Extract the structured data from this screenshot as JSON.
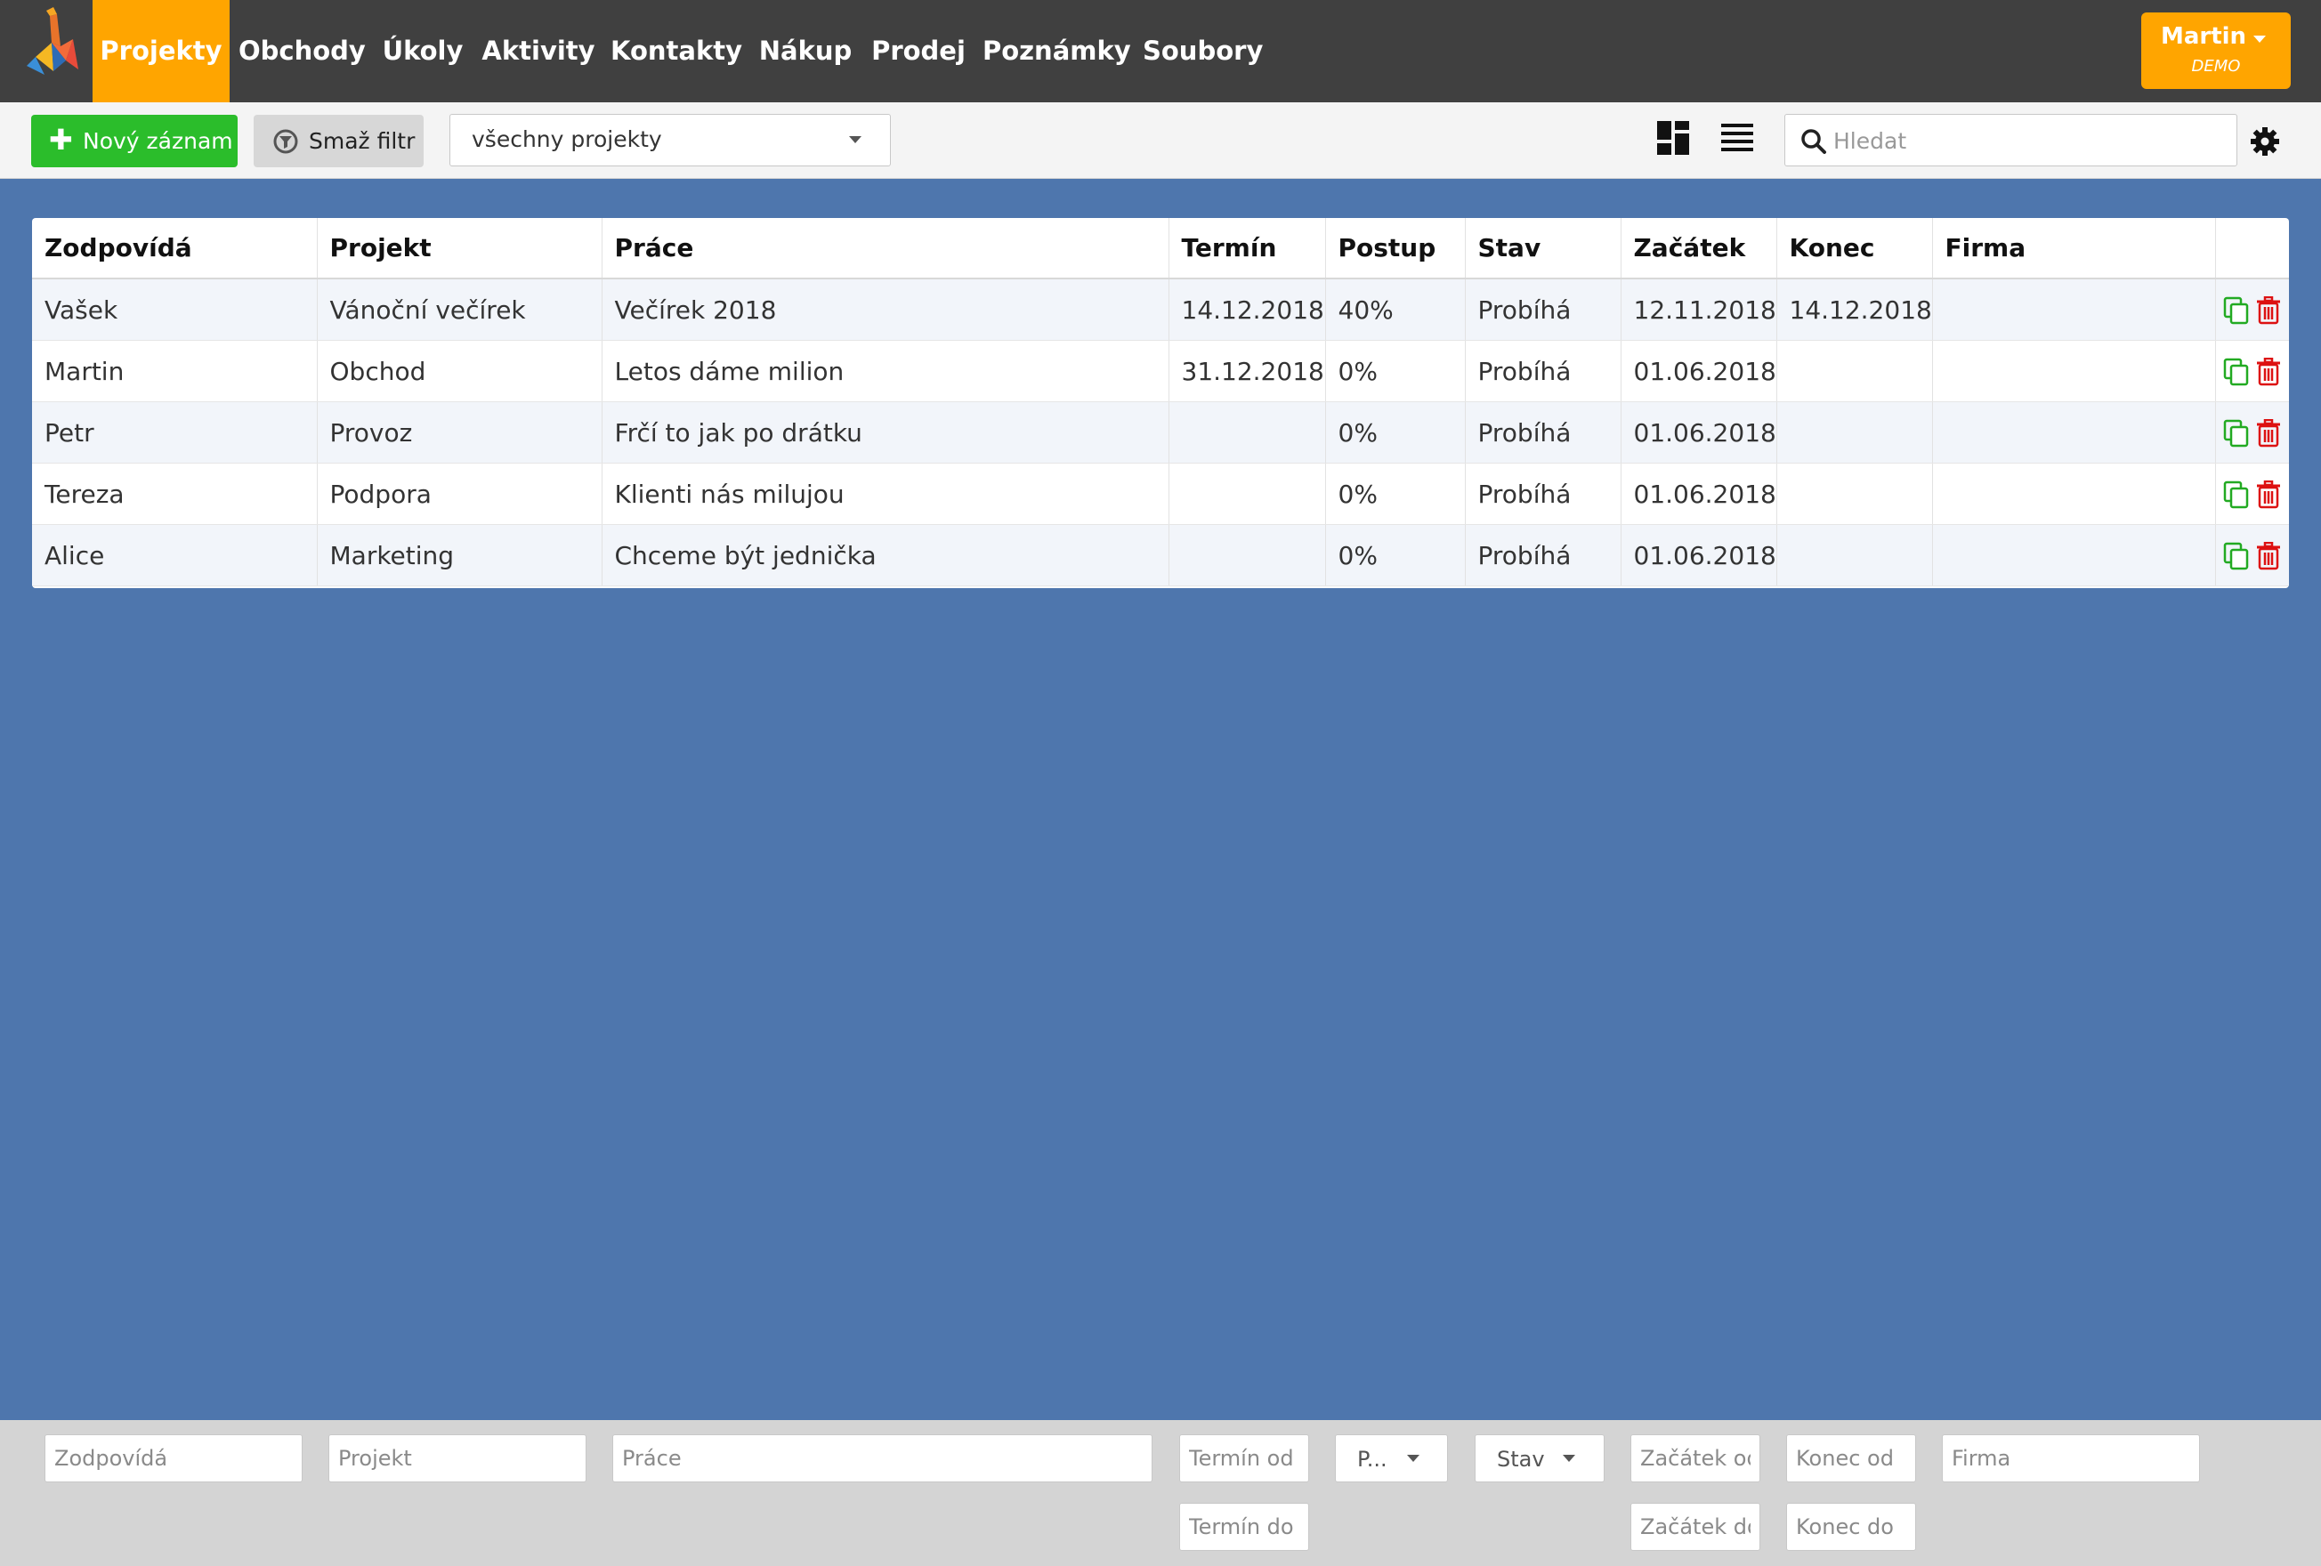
{
  "nav": {
    "items": [
      {
        "label": "Projekty",
        "active": true
      },
      {
        "label": "Obchody"
      },
      {
        "label": "Úkoly"
      },
      {
        "label": "Aktivity"
      },
      {
        "label": "Kontakty"
      },
      {
        "label": "Nákup"
      },
      {
        "label": "Prodej"
      },
      {
        "label": "Poznámky"
      },
      {
        "label": "Soubory"
      }
    ],
    "user": {
      "name": "Martin",
      "subtitle": "DEMO"
    }
  },
  "toolbar": {
    "new_label": "Nový záznam",
    "clear_filter_label": "Smaž filtr",
    "project_select_value": "všechny projekty",
    "search_placeholder": "Hledat"
  },
  "table": {
    "headers": [
      "Zodpovídá",
      "Projekt",
      "Práce",
      "Termín",
      "Postup",
      "Stav",
      "Začátek",
      "Konec",
      "Firma"
    ],
    "rows": [
      [
        "Vašek",
        "Vánoční večírek",
        "Večírek 2018",
        "14.12.2018",
        "40%",
        "Probíhá",
        "12.11.2018",
        "14.12.2018",
        ""
      ],
      [
        "Martin",
        "Obchod",
        "Letos dáme milion",
        "31.12.2018",
        "0%",
        "Probíhá",
        "01.06.2018",
        "",
        ""
      ],
      [
        "Petr",
        "Provoz",
        "Frčí to jak po drátku",
        "",
        "0%",
        "Probíhá",
        "01.06.2018",
        "",
        ""
      ],
      [
        "Tereza",
        "Podpora",
        "Klienti nás milujou",
        "",
        "0%",
        "Probíhá",
        "01.06.2018",
        "",
        ""
      ],
      [
        "Alice",
        "Marketing",
        "Chceme být jednička",
        "",
        "0%",
        "Probíhá",
        "01.06.2018",
        "",
        ""
      ]
    ]
  },
  "filters": {
    "zodpovida": "Zodpovídá",
    "projekt": "Projekt",
    "prace": "Práce",
    "termin_od": "Termín od",
    "termin_do": "Termín do",
    "postup": "P...",
    "stav": "Stav",
    "zacatek_od": "Začátek od",
    "zacatek_do": "Začátek do",
    "konec_od": "Konec od",
    "konec_do": "Konec do",
    "firma": "Firma"
  },
  "colors": {
    "accent": "#ffa500",
    "nav_bg": "#404040",
    "page_bg": "#4e76ad",
    "new_button": "#2bbd2b",
    "copy_icon": "#22aa22",
    "delete_icon": "#dd1111"
  },
  "icons": {
    "logo": "giraffe-logo-icon",
    "new": "plus-icon",
    "clear_filter": "filter-clear-icon",
    "view_grid": "grid-view-icon",
    "view_list": "list-view-icon",
    "search": "search-icon",
    "settings": "gear-icon",
    "row_copy": "copy-icon",
    "row_delete": "trash-icon"
  }
}
